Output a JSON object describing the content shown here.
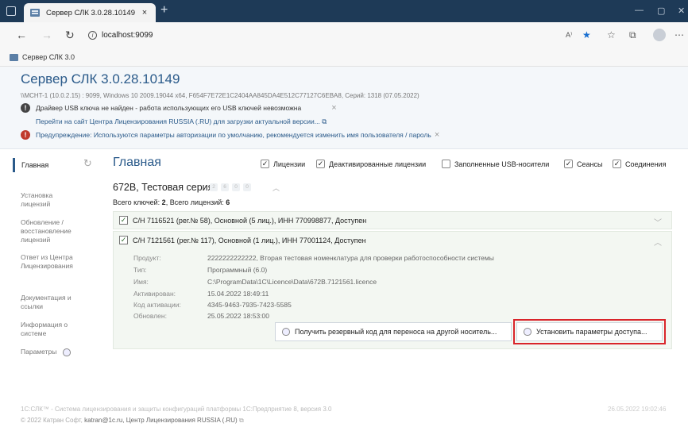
{
  "browser": {
    "tab_title": "Сервер СЛК 3.0.28.10149",
    "tab_close": "×",
    "new_tab": "+",
    "url": "localhost:9099",
    "bookmark": "Сервер СЛК 3.0"
  },
  "header": {
    "title": "Сервер СЛК 3.0.28.10149",
    "server_info": "\\\\MCHT-1 (10.0.2.15) : 9099,  Windows 10 2009.19044 x64,  F654F7E72E1C2404AA845DA4E512C77127C6EBA8,  Серий: 1318 (07.05.2022)",
    "usb_warning": "Драйвер USB ключа не найден - работа использующих его USB ключей невозможна",
    "usb_link": "Перейти на сайт Центра Лицензирования RUSSIA (.RU) для загрузки актуальной версии...",
    "auth_warning": "Предупреждение: Используются параметры авторизации по умолчанию, рекомендуется изменить имя пользователя / пароль",
    "close_glyph": "×"
  },
  "sidebar": {
    "active": "Главная",
    "items": [
      {
        "line1": "Установка",
        "line2": "лицензий",
        "line3": ""
      },
      {
        "line1": "Обновление /",
        "line2": "восстановление",
        "line3": "лицензий"
      },
      {
        "line1": "Ответ из Центра",
        "line2": "Лицензирования",
        "line3": ""
      },
      {
        "line1": "Документация и",
        "line2": "ссылки",
        "line3": ""
      },
      {
        "line1": "Информация о",
        "line2": "системе",
        "line3": ""
      },
      {
        "line1": "Параметры",
        "line2": "",
        "line3": ""
      }
    ]
  },
  "main": {
    "title": "Главная",
    "filters": [
      {
        "label": "Лицензии",
        "checked": true
      },
      {
        "label": "Деактивированные лицензии",
        "checked": true
      },
      {
        "label": "Заполненные USB-носители",
        "checked": false
      },
      {
        "label": "Сеансы",
        "checked": true
      },
      {
        "label": "Соединения",
        "checked": true
      }
    ],
    "check_glyph": "✓",
    "series": {
      "title": "672B, Тестовая серия",
      "badges": [
        "2",
        "6",
        "0",
        "0"
      ],
      "totals_prefix": "Всего ключей: ",
      "keys_count": "2",
      "totals_mid": ",  Всего лицензий: ",
      "licenses_count": "6"
    },
    "keys": [
      {
        "text": "С/Н 7116521 (рег.№ 58),  Основной (5 лиц.),  ИНН 770998877,  Доступен",
        "arrow": "﹀"
      },
      {
        "text": "С/Н 7121561 (рег.№ 117),  Основной (1 лиц.),  ИНН 77001124,  Доступен",
        "arrow": "︿"
      }
    ],
    "details": [
      {
        "label": "Продукт:",
        "value": "2222222222222, Вторая тестовая номенклатура для проверки работоспособности системы"
      },
      {
        "label": "Тип:",
        "value": "Программный (6.0)"
      },
      {
        "label": "Имя:",
        "value": "C:\\ProgramData\\1C\\Licence\\Data\\672B.7121561.licence"
      },
      {
        "label": "Активирован:",
        "value": "15.04.2022 18:49:11"
      },
      {
        "label": "Код активации:",
        "value": "4345-9463-7935-7423-5585"
      },
      {
        "label": "Обновлен:",
        "value": "25.05.2022 18:53:00"
      }
    ],
    "btn_backup": "Получить резервный код для переноса на другой носитель...",
    "btn_access": "Установить параметры доступа..."
  },
  "footer": {
    "line1": "1С:СЛК™ - Система лицензирования и защиты конфигураций платформы 1С:Предприятие 8, версия 3.0",
    "line2_prefix": "© 2022 Катран Софт,",
    "email": "katran@1c.ru,",
    "line2_suffix": "Центр Лицензирования RUSSIA (.RU)",
    "date": "26.05.2022 19:02:46"
  },
  "colors": {
    "accent": "#2a5a8a",
    "warning": "#c0392b",
    "highlight": "#d9252b",
    "titlebar": "#1e3a57"
  }
}
